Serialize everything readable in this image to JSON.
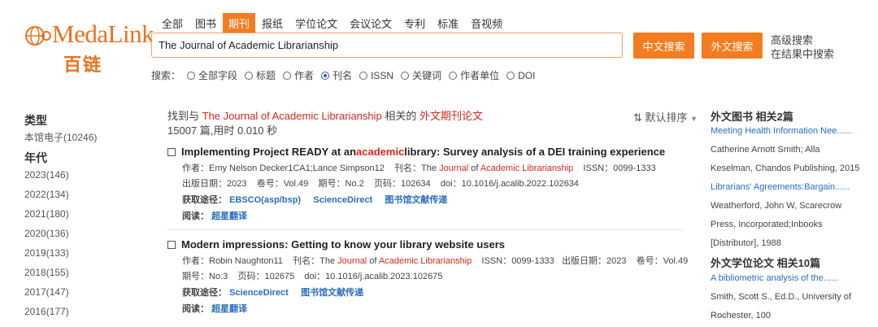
{
  "logo": {
    "name": "MedaLink",
    "cn": "百链"
  },
  "tabs": [
    "全部",
    "图书",
    "期刊",
    "报纸",
    "学位论文",
    "会议论文",
    "专利",
    "标准",
    "音视频"
  ],
  "search": {
    "value": "The Journal of Academic Librarianship",
    "btn_cn": "中文搜索",
    "btn_en": "外文搜索",
    "advanced": "高级搜索",
    "within": "在结果中搜索",
    "fields_label": "搜索：",
    "fields": [
      "全部字段",
      "标题",
      "作者",
      "刊名",
      "ISSN",
      "关键词",
      "作者单位",
      "DOI"
    ],
    "selected_field": "刊名"
  },
  "left": {
    "type_heading": "类型",
    "type_item": "本馆电子(10246)",
    "year_heading": "年代",
    "years": [
      "2023(146)",
      "2022(134)",
      "2021(180)",
      "2020(136)",
      "2019(133)",
      "2018(155)",
      "2017(147)",
      "2016(177)"
    ]
  },
  "summary": {
    "prefix": "找到与",
    "query": "The Journal of Academic Librarianship",
    "mid": "相关的",
    "category": "外文期刊论文",
    "count": "15007 篇,用时 0.010 秒",
    "sort": "默认排序"
  },
  "results": [
    {
      "title_pre": "Implementing Project READY at an ",
      "title_hl": "academic",
      "title_post": " library: Survey analysis of a DEI training experience",
      "line1_authors_label": "作者：",
      "line1_authors": "Emy Nelson Decker1CA1;Lance Simpson12",
      "journal_label": "刊名：",
      "journal_pre": "The ",
      "journal_hl1": "Journal",
      "journal_mid": " of ",
      "journal_hl2": "Academic Librarianship",
      "issn": "ISSN：0099-1333",
      "line2": "出版日期：2023    卷号：Vol.49    期号：No.2    页码：102634    doi：10.1016/j.acalib.2022.102634",
      "access_label": "获取途径：",
      "access": [
        "EBSCO(asp/bsp)",
        "ScienceDirect",
        "图书馆文献传递"
      ],
      "read_label": "阅读：",
      "read": "超星翻译"
    },
    {
      "title_pre": "Modern impressions: Getting to know your library website users",
      "line1_authors_label": "作者：",
      "line1_authors": "Robin Naughton11",
      "journal_label": "刊名：",
      "journal_pre": "The ",
      "journal_hl1": "Journal",
      "journal_mid": " of ",
      "journal_hl2": "Academic Librarianship",
      "issn": "ISSN：0099-1333",
      "date_vol": "出版日期：2023    卷号：Vol.49",
      "line2": "期号：No.3    页码：102675    doi：10.1016/j.acalib.2023.102675",
      "access_label": "获取途径：",
      "access": [
        "ScienceDirect",
        "图书馆文献传递"
      ],
      "read_label": "阅读：",
      "read": "超星翻译"
    }
  ],
  "right": {
    "books_heading": "外文图书  相关2篇",
    "book_link": "Meeting Health Information Nee......",
    "book_lines": [
      "Catherine Arnott Smith; Alla",
      "Keselman, Chandos Publishing, 2015"
    ],
    "book2_link": "Librarians' Agreements:Bargain......",
    "book2_lines": [
      "Weatherford, John W, Scarecrow",
      "Press, Incorporated;Inbooks",
      "[Distributor], 1988"
    ],
    "thesis_heading": "外文学位论文  相关10篇",
    "thesis_link": "A bibliometric analysis of the......",
    "thesis_lines": [
      "Smith, Scott S., Ed.D., University of",
      "Rochester, 100"
    ]
  },
  "colors": {
    "accent": "#f47c20",
    "highlight": "#d9261c",
    "link": "#2a6ebb"
  }
}
